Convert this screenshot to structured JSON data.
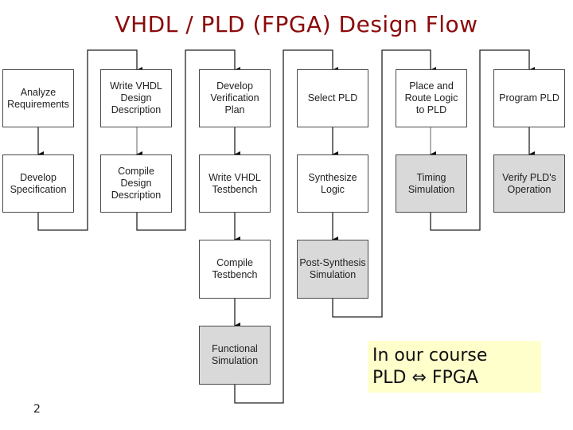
{
  "title": "VHDL / PLD (FPGA) Design Flow",
  "steps": {
    "analyze": "Analyze\nRequirements",
    "develop_spec": "Develop\nSpecification",
    "write_vhdl_design": "Write VHDL\nDesign\nDescription",
    "compile_design": "Compile\nDesign\nDescription",
    "develop_verif": "Develop\nVerification\nPlan",
    "write_testbench": "Write VHDL\nTestbench",
    "compile_testbench": "Compile\nTestbench",
    "functional_sim": "Functional\nSimulation",
    "select_pld": "Select PLD",
    "synthesize": "Synthesize\nLogic",
    "post_synth_sim": "Post-Synthesis\nSimulation",
    "place_route": "Place and\nRoute Logic\nto PLD",
    "timing_sim": "Timing\nSimulation",
    "program_pld": "Program PLD",
    "verify_pld": "Verify PLD's\nOperation"
  },
  "note": {
    "line1": "In our course",
    "line2": "PLD ⇔ FPGA"
  },
  "page_number": "2",
  "colors": {
    "title": "#8b0a0a",
    "simulation_box": "#d9d9d9",
    "note_background": "#ffffcc"
  }
}
